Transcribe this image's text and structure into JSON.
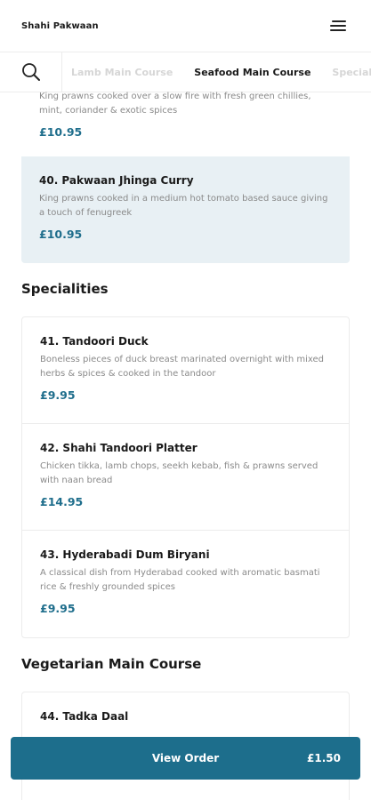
{
  "header": {
    "brand": "Shahi Pakwaan"
  },
  "categories": {
    "tabs": [
      {
        "label": "Lamb Main Course",
        "active": false
      },
      {
        "label": "Seafood Main Course",
        "active": true
      },
      {
        "label": "Specialities",
        "active": false
      }
    ]
  },
  "seafood": {
    "partial_item": {
      "description": "King prawns cooked over a slow fire with fresh green chillies, mint, coriander & exotic spices",
      "price": "£10.95"
    },
    "highlighted_item": {
      "name": "40. Pakwaan Jhinga Curry",
      "description": "King prawns cooked in a medium hot tomato based sauce giving a touch of fenugreek",
      "price": "£10.95"
    }
  },
  "specialities": {
    "title": "Specialities",
    "items": [
      {
        "name": "41. Tandoori Duck",
        "description": "Boneless pieces of duck breast marinated overnight with mixed herbs & spices & cooked in the tandoor",
        "price": "£9.95"
      },
      {
        "name": "42. Shahi Tandoori Platter",
        "description": "Chicken tikka, lamb chops, seekh kebab, fish & prawns served with naan bread",
        "price": "£14.95"
      },
      {
        "name": "43. Hyderabadi Dum Biryani",
        "description": "A classical dish from Hyderabad cooked with aromatic basmati rice & freshly grounded spices",
        "price": "£9.95"
      }
    ]
  },
  "vegetarian": {
    "title": "Vegetarian Main Course",
    "items": [
      {
        "name": "44. Tadka Daal"
      }
    ]
  },
  "order_bar": {
    "label": "View Order",
    "total": "£1.50"
  },
  "colors": {
    "accent": "#1d6e8c",
    "price": "#1f6e8c",
    "highlight_bg": "#e8f0f4"
  }
}
